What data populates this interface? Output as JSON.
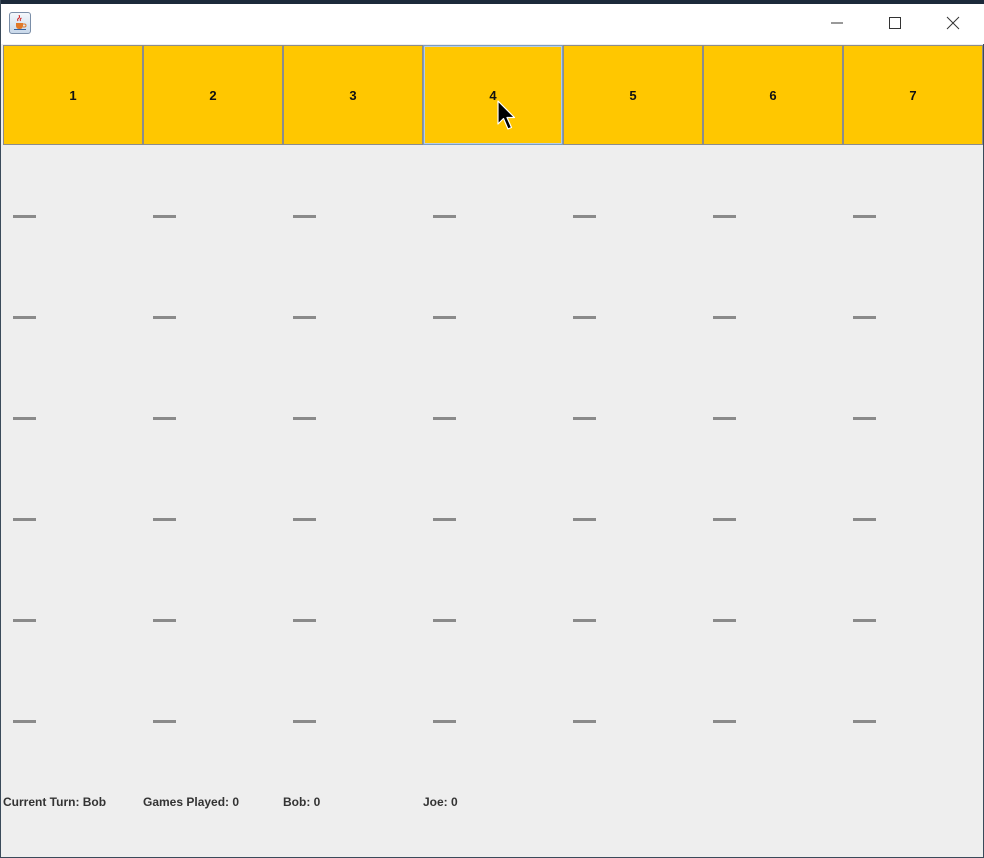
{
  "window": {
    "title": "",
    "icon": "java-cup-icon",
    "controls": [
      "minimize-icon",
      "maximize-icon",
      "close-icon"
    ]
  },
  "columns": [
    {
      "label": "1"
    },
    {
      "label": "2"
    },
    {
      "label": "3"
    },
    {
      "label": "4",
      "focused": true
    },
    {
      "label": "5"
    },
    {
      "label": "6"
    },
    {
      "label": "7"
    }
  ],
  "board": {
    "rows": 6,
    "cols": 7,
    "cells": [
      [
        "—",
        "—",
        "—",
        "—",
        "—",
        "—",
        "—"
      ],
      [
        "—",
        "—",
        "—",
        "—",
        "—",
        "—",
        "—"
      ],
      [
        "—",
        "—",
        "—",
        "—",
        "—",
        "—",
        "—"
      ],
      [
        "—",
        "—",
        "—",
        "—",
        "—",
        "—",
        "—"
      ],
      [
        "—",
        "—",
        "—",
        "—",
        "—",
        "—",
        "—"
      ],
      [
        "—",
        "—",
        "—",
        "—",
        "—",
        "—",
        "—"
      ]
    ]
  },
  "status": {
    "current_turn": "Current Turn: Bob",
    "games_played": "Games Played: 0",
    "player1_score": "Bob: 0",
    "player2_score": "Joe: 0"
  },
  "colors": {
    "column_button": "#ffc700",
    "background": "#eeeeee",
    "empty_slot": "#8a8a8a"
  }
}
